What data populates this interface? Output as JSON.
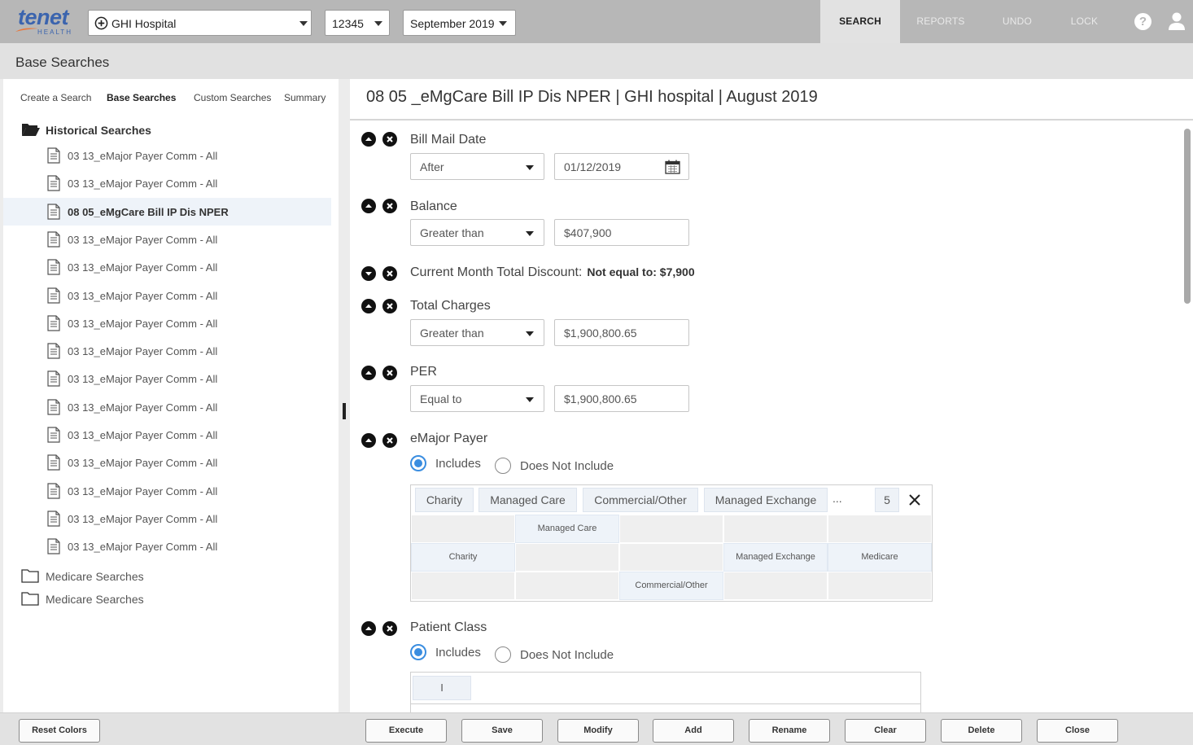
{
  "header": {
    "logo_text": "tenet",
    "logo_subtext": "HEALTH",
    "hospital_select": "GHI Hospital",
    "id_select": "12345",
    "month_select": "September 2019",
    "nav": {
      "search": "SEARCH",
      "reports": "REPORTS",
      "undo": "UNDO",
      "lock": "LOCK",
      "help": "?"
    }
  },
  "subheader": {
    "title": "Base Searches"
  },
  "left_panel": {
    "tabs": [
      "Create a Search",
      "Base Searches",
      "Custom Searches",
      "Summary"
    ],
    "active_tab": "Base Searches",
    "tree": {
      "root_label": "Historical Searches",
      "items": [
        "03 13_eMajor Payer Comm - All",
        "03 13_eMajor Payer Comm - All",
        "08 05_eMgCare Bill IP Dis NPER",
        "03 13_eMajor Payer Comm - All",
        "03 13_eMajor Payer Comm - All",
        "03 13_eMajor Payer Comm - All",
        "03 13_eMajor Payer Comm - All",
        "03 13_eMajor Payer Comm - All",
        "03 13_eMajor Payer Comm - All",
        "03 13_eMajor Payer Comm - All",
        "03 13_eMajor Payer Comm - All",
        "03 13_eMajor Payer Comm - All",
        "03 13_eMajor Payer Comm - All",
        "03 13_eMajor Payer Comm - All",
        "03 13_eMajor Payer Comm - All"
      ],
      "selected_index": 2,
      "folders": [
        "Medicare Searches",
        "Medicare Searches"
      ]
    }
  },
  "main": {
    "title": "08 05 _eMgCare Bill IP Dis NPER | GHI hospital | August 2019",
    "criteria": {
      "bill_mail_date": {
        "label": "Bill Mail Date",
        "operator": "After",
        "value": "01/12/2019"
      },
      "balance": {
        "label": "Balance",
        "operator": "Greater than",
        "value": "$407,900"
      },
      "discount": {
        "label": "Current Month Total Discount:",
        "summary": "Not equal to: $7,900"
      },
      "total_charges": {
        "label": "Total Charges",
        "operator": "Greater than",
        "value": "$1,900,800.65"
      },
      "per": {
        "label": "PER",
        "operator": "Equal to",
        "value": "$1,900,800.65"
      },
      "emajor_payer": {
        "label": "eMajor Payer",
        "includes_label": "Includes",
        "excludes_label": "Does Not Include",
        "selected": "Includes",
        "tags": [
          "Charity",
          "Managed Care",
          "Commercial/Other",
          "Managed Exchange"
        ],
        "ellipsis": "...",
        "count": "5",
        "close": "×",
        "grid": {
          "managed_care": "Managed Care",
          "charity": "Charity",
          "managed_exchange": "Managed Exchange",
          "medicare": "Medicare",
          "commercial_other": "Commercial/Other"
        }
      },
      "patient_class": {
        "label": "Patient Class",
        "includes_label": "Includes",
        "excludes_label": "Does Not Include",
        "selected": "Includes",
        "tag": "I"
      }
    }
  },
  "footer": {
    "reset_colors": "Reset Colors",
    "execute": "Execute",
    "save": "Save",
    "modify": "Modify",
    "add": "Add",
    "rename": "Rename",
    "clear": "Clear",
    "delete": "Delete",
    "close": "Close"
  },
  "colors": {
    "brand": "#3b64ae",
    "accent": "#3a8de0",
    "topbar": "#b7b7b7"
  }
}
